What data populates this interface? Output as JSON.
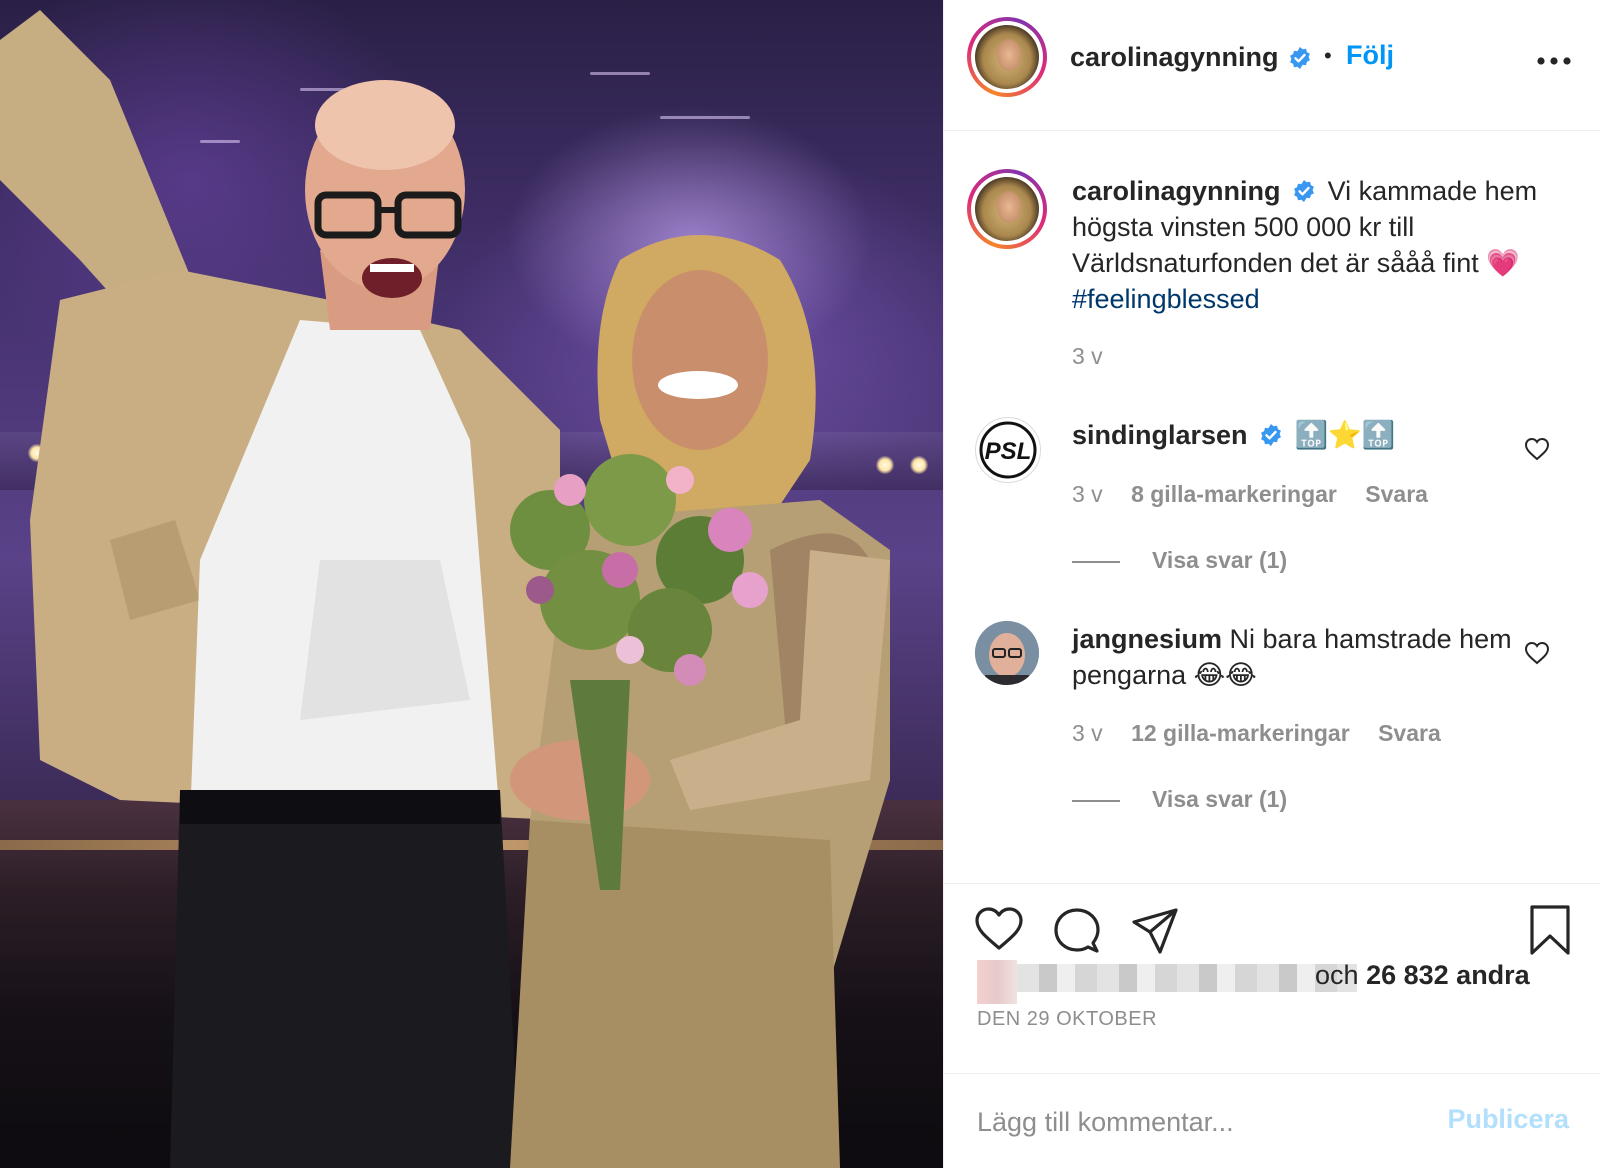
{
  "post": {
    "image_alt_people": [
      "man-with-raised-arm",
      "woman-holding-bouquet"
    ],
    "colors": {
      "accent": "#0095f6",
      "hashtag": "#00376b",
      "muted": "#8e8e8e",
      "text": "#262626",
      "publish_disabled": "#b2dffc"
    }
  },
  "header": {
    "username": "carolinagynning",
    "dot": "•",
    "follow_label": "Följ",
    "verified_icon": "verified-badge-icon",
    "more_icon": "more-options-icon"
  },
  "caption": {
    "username": "carolinagynning",
    "text": "Vi kammade hem högsta vinsten 500 000 kr till Världsnaturfonden det är sååå fint 💗",
    "hashtag": "#feelingblessed",
    "age": "3 v"
  },
  "comments": [
    {
      "username": "sindinglarsen",
      "verified": true,
      "text": "🔝⭐️🔝",
      "age": "3 v",
      "likes": "8 gilla-markeringar",
      "reply": "Svara",
      "view_replies": "Visa svar (1)",
      "avatar_text": "PSL"
    },
    {
      "username": "jangnesium",
      "verified": false,
      "text": "Ni bara hamstrade hem pengarna 😂😂",
      "age": "3 v",
      "likes": "12 gilla-markeringar",
      "reply": "Svara",
      "view_replies": "Visa svar (1)"
    }
  ],
  "actions": {
    "icons": [
      "heart-icon",
      "comment-icon",
      "share-icon",
      "bookmark-icon"
    ],
    "likes_prefix": "och",
    "likes_count": "26 832",
    "likes_suffix": "andra",
    "date": "DEN 29 OKTOBER"
  },
  "add_comment": {
    "placeholder": "Lägg till kommentar...",
    "publish_label": "Publicera"
  }
}
